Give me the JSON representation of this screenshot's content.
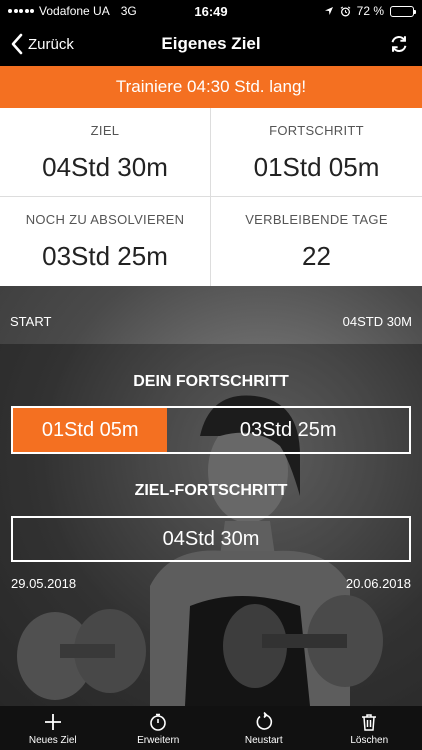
{
  "status": {
    "carrier": "Vodafone UA",
    "network": "3G",
    "time": "16:49",
    "battery": "72 %",
    "battery_level": 0.72
  },
  "nav": {
    "back_label": "Zurück",
    "title": "Eigenes Ziel"
  },
  "banner": "Trainiere 04:30 Std. lang!",
  "stats": {
    "goal": {
      "label": "ZIEL",
      "value": "04Std 30m"
    },
    "progress": {
      "label": "FORTSCHRITT",
      "value": "01Std 05m"
    },
    "remaining": {
      "label": "NOCH ZU ABSOLVIEREN",
      "value": "03Std 25m"
    },
    "days_left": {
      "label": "VERBLEIBENDE TAGE",
      "value": "22"
    }
  },
  "hero": {
    "start_label": "START",
    "end_label": "04STD 30M",
    "your_progress_title": "DEIN FORTSCHRITT",
    "progress_done": "01Std 05m",
    "progress_rest": "03Std 25m",
    "progress_fraction": 0.24,
    "goal_progress_title": "ZIEL-FORTSCHRITT",
    "goal_value": "04Std 30m",
    "start_date": "29.05.2018",
    "end_date": "20.06.2018"
  },
  "tabs": [
    {
      "label": "Neues Ziel",
      "icon": "plus-icon"
    },
    {
      "label": "Erweitern",
      "icon": "stopwatch-icon"
    },
    {
      "label": "Neustart",
      "icon": "restart-icon"
    },
    {
      "label": "Löschen",
      "icon": "trash-icon"
    }
  ],
  "colors": {
    "accent": "#f47021"
  }
}
